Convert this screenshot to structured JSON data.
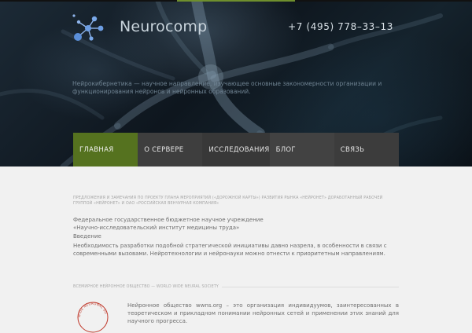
{
  "header": {
    "logo_text": "Neurocomp",
    "phone": "+7 (495) 778–33–13",
    "tagline": "Нейрокибернетика — научное направление, изучающее основные закономерности организации и функционирования нейронов и нейронных образований."
  },
  "nav": {
    "items": [
      {
        "label": "ГЛАВНАЯ"
      },
      {
        "label": "О СЕРВЕРЕ"
      },
      {
        "label": "ИССЛЕДОВАНИЯ"
      },
      {
        "label": "БЛОГ"
      },
      {
        "label": "СВЯЗЬ"
      }
    ],
    "active_index": 0
  },
  "content": {
    "breadcrumb": "ПРЕДЛОЖЕНИЯ И ЗАМЕЧАНИЯ ПО ПРОЕКТУ ПЛАНА МЕРОПРИЯТИЙ («ДОРОЖНОЙ КАРТЫ») РАЗВИТИЯ РЫНКА «НЕЙРОНЕТ» ДОРАБОТАННЫЙ РАБОЧЕЙ ГРУППОЙ «НЕЙРОНЕТ» И ОАО «РОССИЙСКАЯ ВЕНЧУРНАЯ КОМПАНИЯ»",
    "org_line1": "Федеральное государственное бюджетное научное учреждение",
    "org_line2": "«Научно-исследовательский институт медицины труда»",
    "intro": "Введение",
    "paragraph": "Необходимость разработки подобной стратегической инициативы давно назрела, в особенности в связи с современными вызовами. Нейротехнологии и нейронауки можно отнести к приоритетным направлениям."
  },
  "society": {
    "heading": "ВСЕМИРНОЕ НЕЙРОННОЕ ОБЩЕСТВО — WORLD WIDE NEURAL SOCIETY",
    "logo_arc_text": "WIDE NEURONAL SO",
    "text": "Нейронное общество wwns.org – это организация индивидуумов, заинтересованных в теоретическом и прикладном понимании нейронных сетей и применении этих знаний для научного прогресса."
  },
  "colors": {
    "accent_green": "#55721f",
    "nav_dark": "#3a3a3a",
    "page_bg": "#f1f1f1",
    "hero_dark": "#0e161e",
    "logo_blue": "#5b8fd9",
    "society_red": "#c0392b"
  }
}
